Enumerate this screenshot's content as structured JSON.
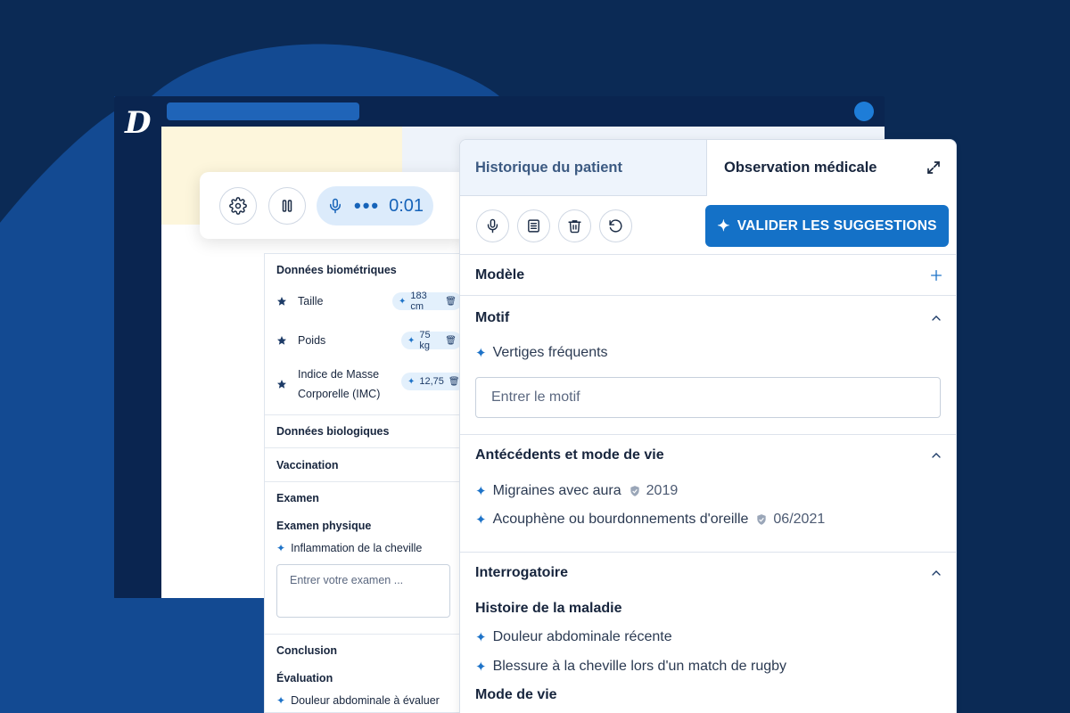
{
  "colors": {
    "background": "#0b2a55",
    "accent": "#1471c7",
    "panel": "#ffffff",
    "chip": "#e3f0fc"
  },
  "app": {
    "logo": "D"
  },
  "recording": {
    "timer": "0:01",
    "icons": [
      "gear-icon",
      "pause-icon",
      "microphone-icon"
    ]
  },
  "form": {
    "biometrics_title": "Données biométriques",
    "biometrics": [
      {
        "label": "Taille",
        "value": "183 cm"
      },
      {
        "label": "Poids",
        "value": "75 kg"
      },
      {
        "label_line1": "Indice de Masse",
        "label_line2": "Corporelle (IMC)",
        "value": "12,75"
      }
    ],
    "biological_title": "Données biologiques",
    "vaccination_title": "Vaccination",
    "exam_title": "Examen",
    "physical_exam_title": "Examen physique",
    "physical_exam_item": "Inflammation de la cheville",
    "exam_placeholder": "Entrer votre examen ...",
    "conclusion_title": "Conclusion",
    "evaluation_title": "Évaluation",
    "evaluation_item": "Douleur abdominale à évaluer"
  },
  "observation": {
    "tab_history": "Historique du patient",
    "tab_observation": "Observation médicale",
    "validate_label": "VALIDER LES SUGGESTIONS",
    "model_title": "Modèle",
    "motif_title": "Motif",
    "motif_item": "Vertiges fréquents",
    "motif_placeholder": "Entrer le motif",
    "history_title": "Antécédents et mode de vie",
    "history_items": [
      {
        "text": "Migraines avec aura",
        "date": "2019"
      },
      {
        "text": "Acouphène ou bourdonnements d'oreille",
        "date": "06/2021"
      }
    ],
    "interrogatoire_title": "Interrogatoire",
    "illness_history_title": "Histoire de la maladie",
    "illness_items": [
      "Douleur abdominale récente",
      "Blessure à la cheville lors d'un match de rugby"
    ],
    "lifestyle_title": "Mode de vie"
  }
}
